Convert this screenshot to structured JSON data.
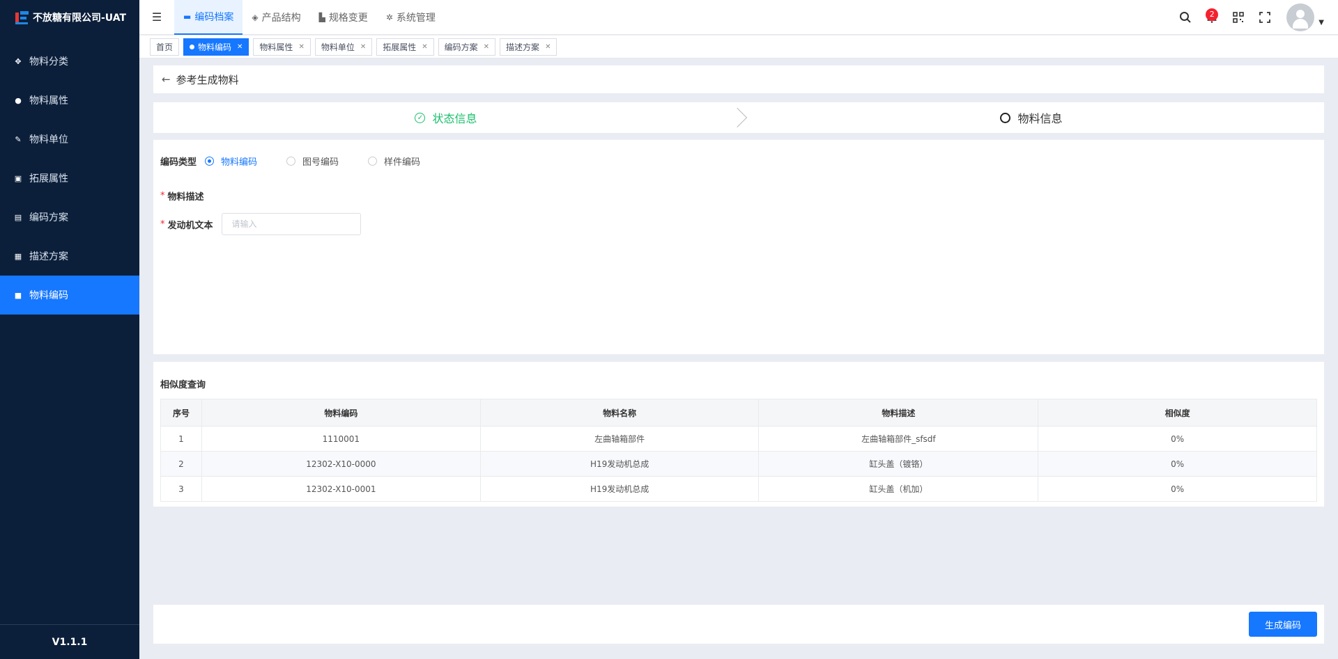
{
  "app": {
    "title": "不放糖有限公司-UAT",
    "version": "V1.1.1"
  },
  "sidebar": {
    "items": [
      {
        "label": "物料分类",
        "icon": "grid-icon"
      },
      {
        "label": "物料属性",
        "icon": "info-icon"
      },
      {
        "label": "物料单位",
        "icon": "ruler-icon"
      },
      {
        "label": "拓展属性",
        "icon": "puzzle-icon"
      },
      {
        "label": "编码方案",
        "icon": "book-icon"
      },
      {
        "label": "描述方案",
        "icon": "doc-icon"
      },
      {
        "label": "物料编码",
        "icon": "note-icon",
        "active": true
      }
    ]
  },
  "header": {
    "nav": [
      {
        "label": "编码档案",
        "active": true
      },
      {
        "label": "产品结构"
      },
      {
        "label": "规格变更"
      },
      {
        "label": "系统管理"
      }
    ],
    "notification_count": "2"
  },
  "tags": [
    {
      "label": "首页"
    },
    {
      "label": "物料编码",
      "active": true
    },
    {
      "label": "物料属性"
    },
    {
      "label": "物料单位"
    },
    {
      "label": "拓展属性"
    },
    {
      "label": "编码方案"
    },
    {
      "label": "描述方案"
    }
  ],
  "page": {
    "title": "参考生成物料",
    "steps": [
      {
        "label": "状态信息",
        "status": "done"
      },
      {
        "label": "物料信息",
        "status": "todo"
      }
    ]
  },
  "form": {
    "code_type_label": "编码类型",
    "code_type_options": [
      "物料编码",
      "图号编码",
      "样件编码"
    ],
    "code_type_selected": "物料编码",
    "material_desc_label": "物料描述",
    "engine_text_label": "发动机文本",
    "engine_text_placeholder": "请输入",
    "engine_text_value": ""
  },
  "similarity": {
    "title": "相似度查询",
    "columns": [
      "序号",
      "物料编码",
      "物料名称",
      "物料描述",
      "相似度"
    ],
    "rows": [
      [
        "1",
        "1110001",
        "左曲轴箱部件",
        "左曲轴箱部件_sfsdf",
        "0%"
      ],
      [
        "2",
        "12302-X10-0000",
        "H19发动机总成",
        "缸头盖（镀铬）",
        "0%"
      ],
      [
        "3",
        "12302-X10-0001",
        "H19发动机总成",
        "缸头盖（机加）",
        "0%"
      ]
    ]
  },
  "footer": {
    "generate_label": "生成编码"
  },
  "colors": {
    "primary": "#1677ff",
    "sidebar_bg": "#0b1f3a",
    "success": "#19be6b",
    "danger": "#f5222d"
  }
}
